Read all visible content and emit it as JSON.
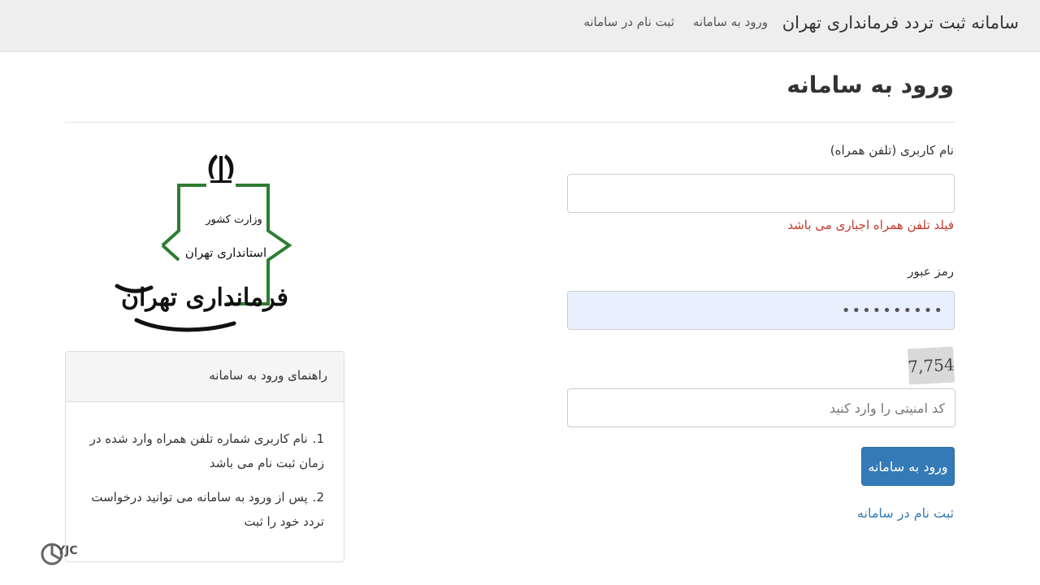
{
  "navbar": {
    "brand": "سامانه ثبت تردد فرمانداری تهران",
    "login_link": "ورود به سامانه",
    "register_link": "ثبت نام در سامانه"
  },
  "page": {
    "title": "ورود به سامانه"
  },
  "form": {
    "username_label": "نام کاربری (تلفن همراه)",
    "username_value": "",
    "username_error": "فیلد تلفن همراه اجباری می باشد",
    "password_label": "رمز عبور",
    "password_value": "••••••••••",
    "captcha_text": "7,754",
    "captcha_placeholder": "کد امنیتی را وارد کنید",
    "submit_label": "ورود به سامانه",
    "register_link": "ثبت نام در سامانه"
  },
  "logo": {
    "line1": "وزارت کشور",
    "line2": "استانداری تهران",
    "line3": "فرمانداری تهران",
    "icon": "iran-emblem-icon"
  },
  "guide": {
    "title": "راهنمای ورود به سامانه",
    "items": [
      {
        "num": "1.",
        "text": "نام کاربری شماره تلفن همراه وارد شده در زمان ثبت نام می باشد"
      },
      {
        "num": "2.",
        "text": "پس از ورود به سامانه می توانید درخواست تردد خود را ثبت"
      }
    ]
  },
  "watermark": {
    "text": "YJC"
  },
  "colors": {
    "primary": "#337ab7",
    "error": "#c0392b",
    "navbar_bg": "#eeeeee",
    "autofill_bg": "#e8f0fe",
    "logo_green": "#2e7d32"
  }
}
